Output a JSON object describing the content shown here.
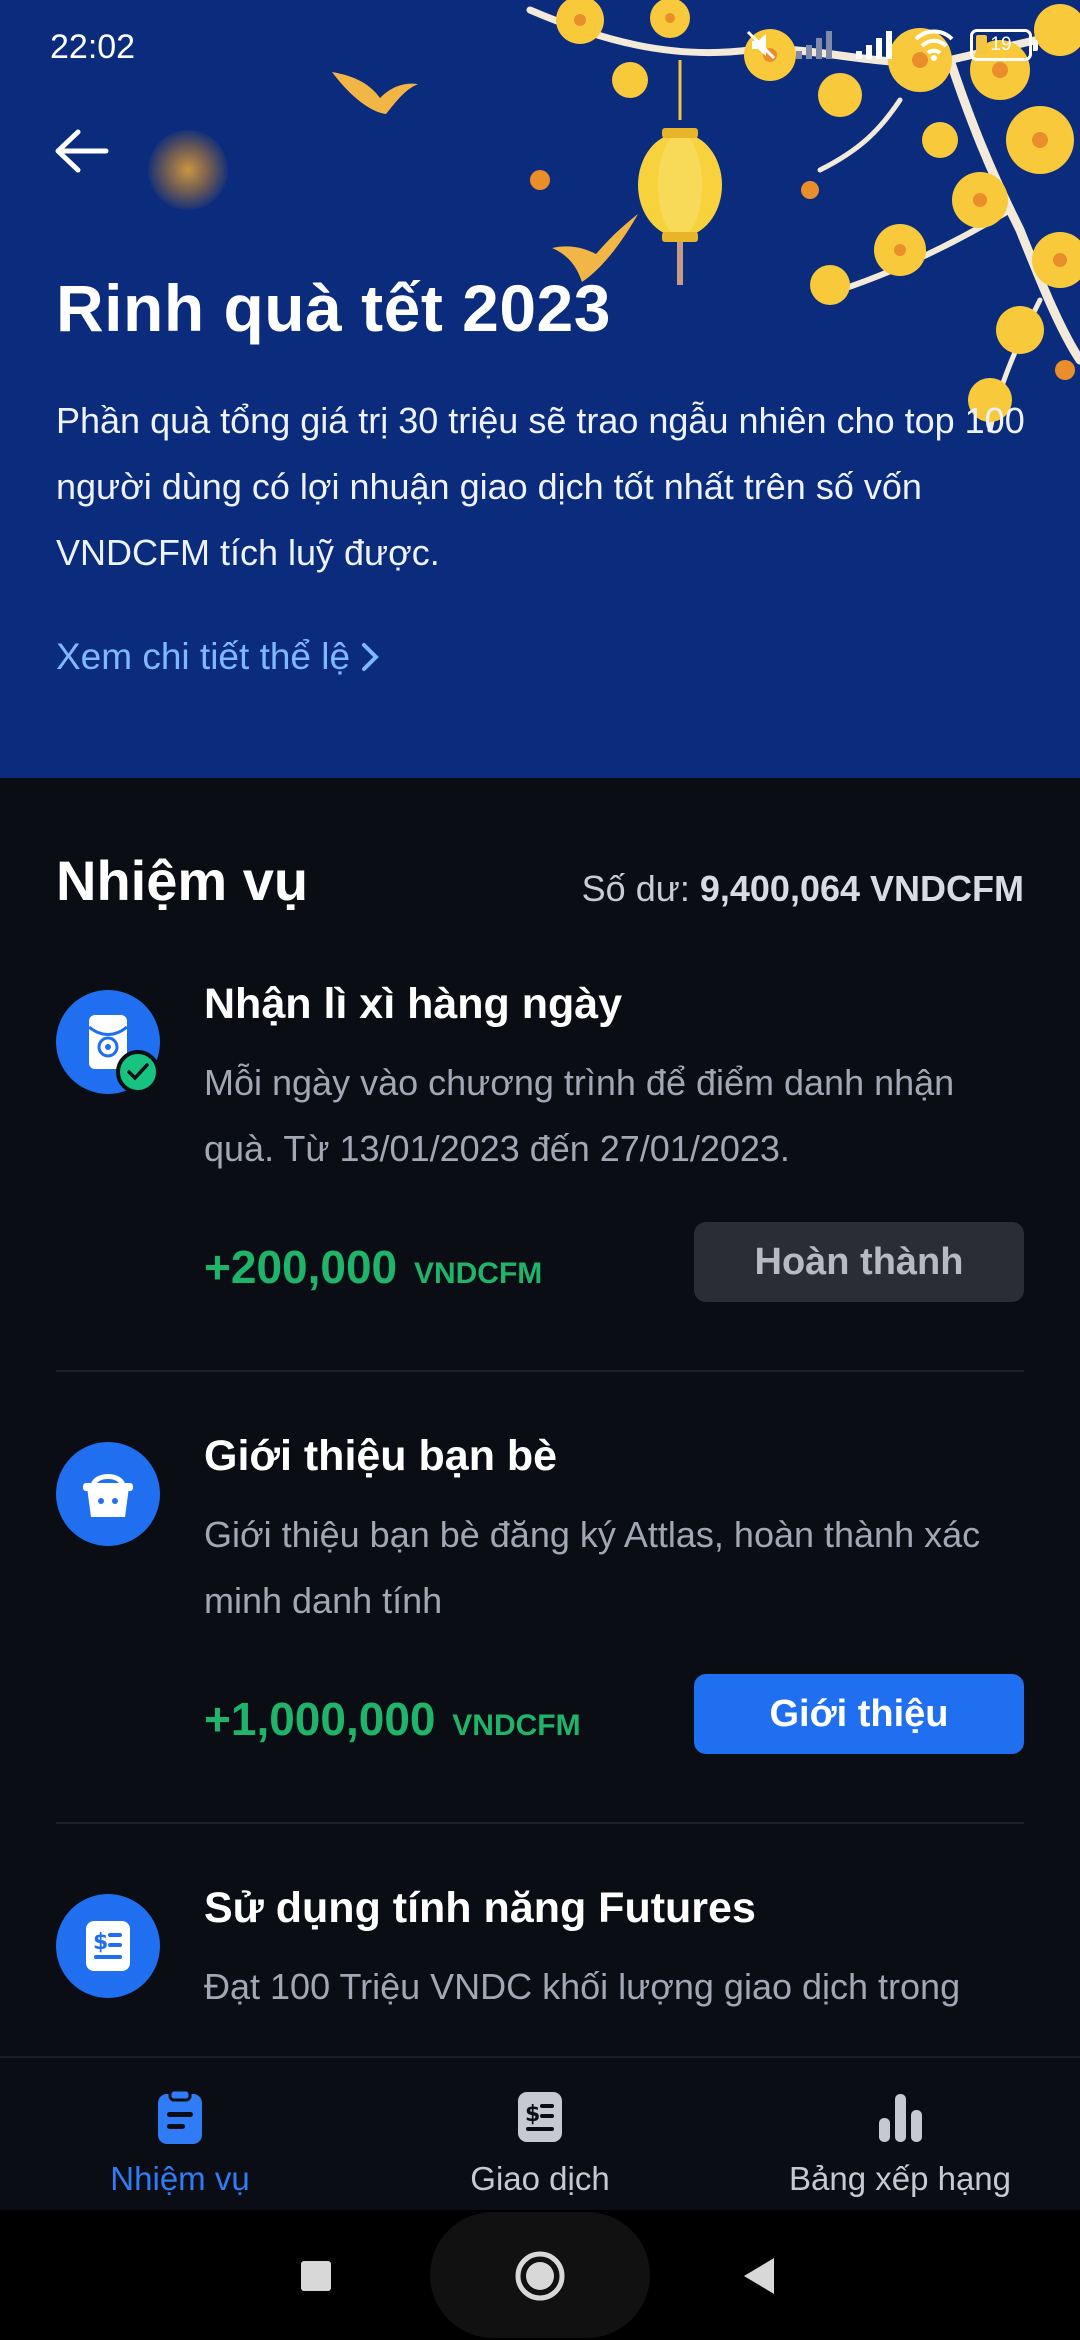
{
  "status_bar": {
    "time": "22:02",
    "battery": "19"
  },
  "hero": {
    "title": "Rinh quà tết 2023",
    "description": "Phần quà tổng giá trị 30 triệu sẽ trao ngẫu nhiên cho top 100 người dùng có lợi nhuận giao dịch tốt nhất trên số vốn VNDCFM tích luỹ được.",
    "link_label": "Xem chi tiết thể lệ"
  },
  "missions": {
    "title": "Nhiệm vụ",
    "balance_label": "Số dư:",
    "balance_value": "9,400,064 VNDCFM",
    "tasks": [
      {
        "title": "Nhận lì xì hàng ngày",
        "description": "Mỗi ngày vào chương trình để điểm danh nhận quà. Từ 13/01/2023 đến 27/01/2023.",
        "reward_amount": "+200,000",
        "reward_unit": "VNDCFM",
        "button_label": "Hoàn thành",
        "icon": "red-envelope-icon",
        "completed": true
      },
      {
        "title": "Giới thiệu bạn bè",
        "description": "Giới thiệu bạn bè đăng ký Attlas, hoàn thành xác minh danh tính",
        "reward_amount": "+1,000,000",
        "reward_unit": "VNDCFM",
        "button_label": "Giới thiệu",
        "icon": "gift-basket-icon",
        "completed": false
      },
      {
        "title": "Sử dụng tính năng Futures",
        "description": "Đạt 100 Triệu VNDC khối lượng giao dịch trong",
        "icon": "futures-document-icon"
      }
    ]
  },
  "bottom_nav": {
    "items": [
      {
        "label": "Nhiệm vụ",
        "icon": "clipboard-icon",
        "active": true
      },
      {
        "label": "Giao dịch",
        "icon": "transaction-icon",
        "active": false
      },
      {
        "label": "Bảng xếp hạng",
        "icon": "bar-chart-icon",
        "active": false
      }
    ]
  },
  "colors": {
    "hero_bg": "#0b2b7c",
    "page_bg": "#0b0d14",
    "accent_blue": "#1f6ff0",
    "reward_green": "#1fb46a",
    "link_blue": "#7fb8ff",
    "blossom_yellow": "#f8c93a"
  }
}
